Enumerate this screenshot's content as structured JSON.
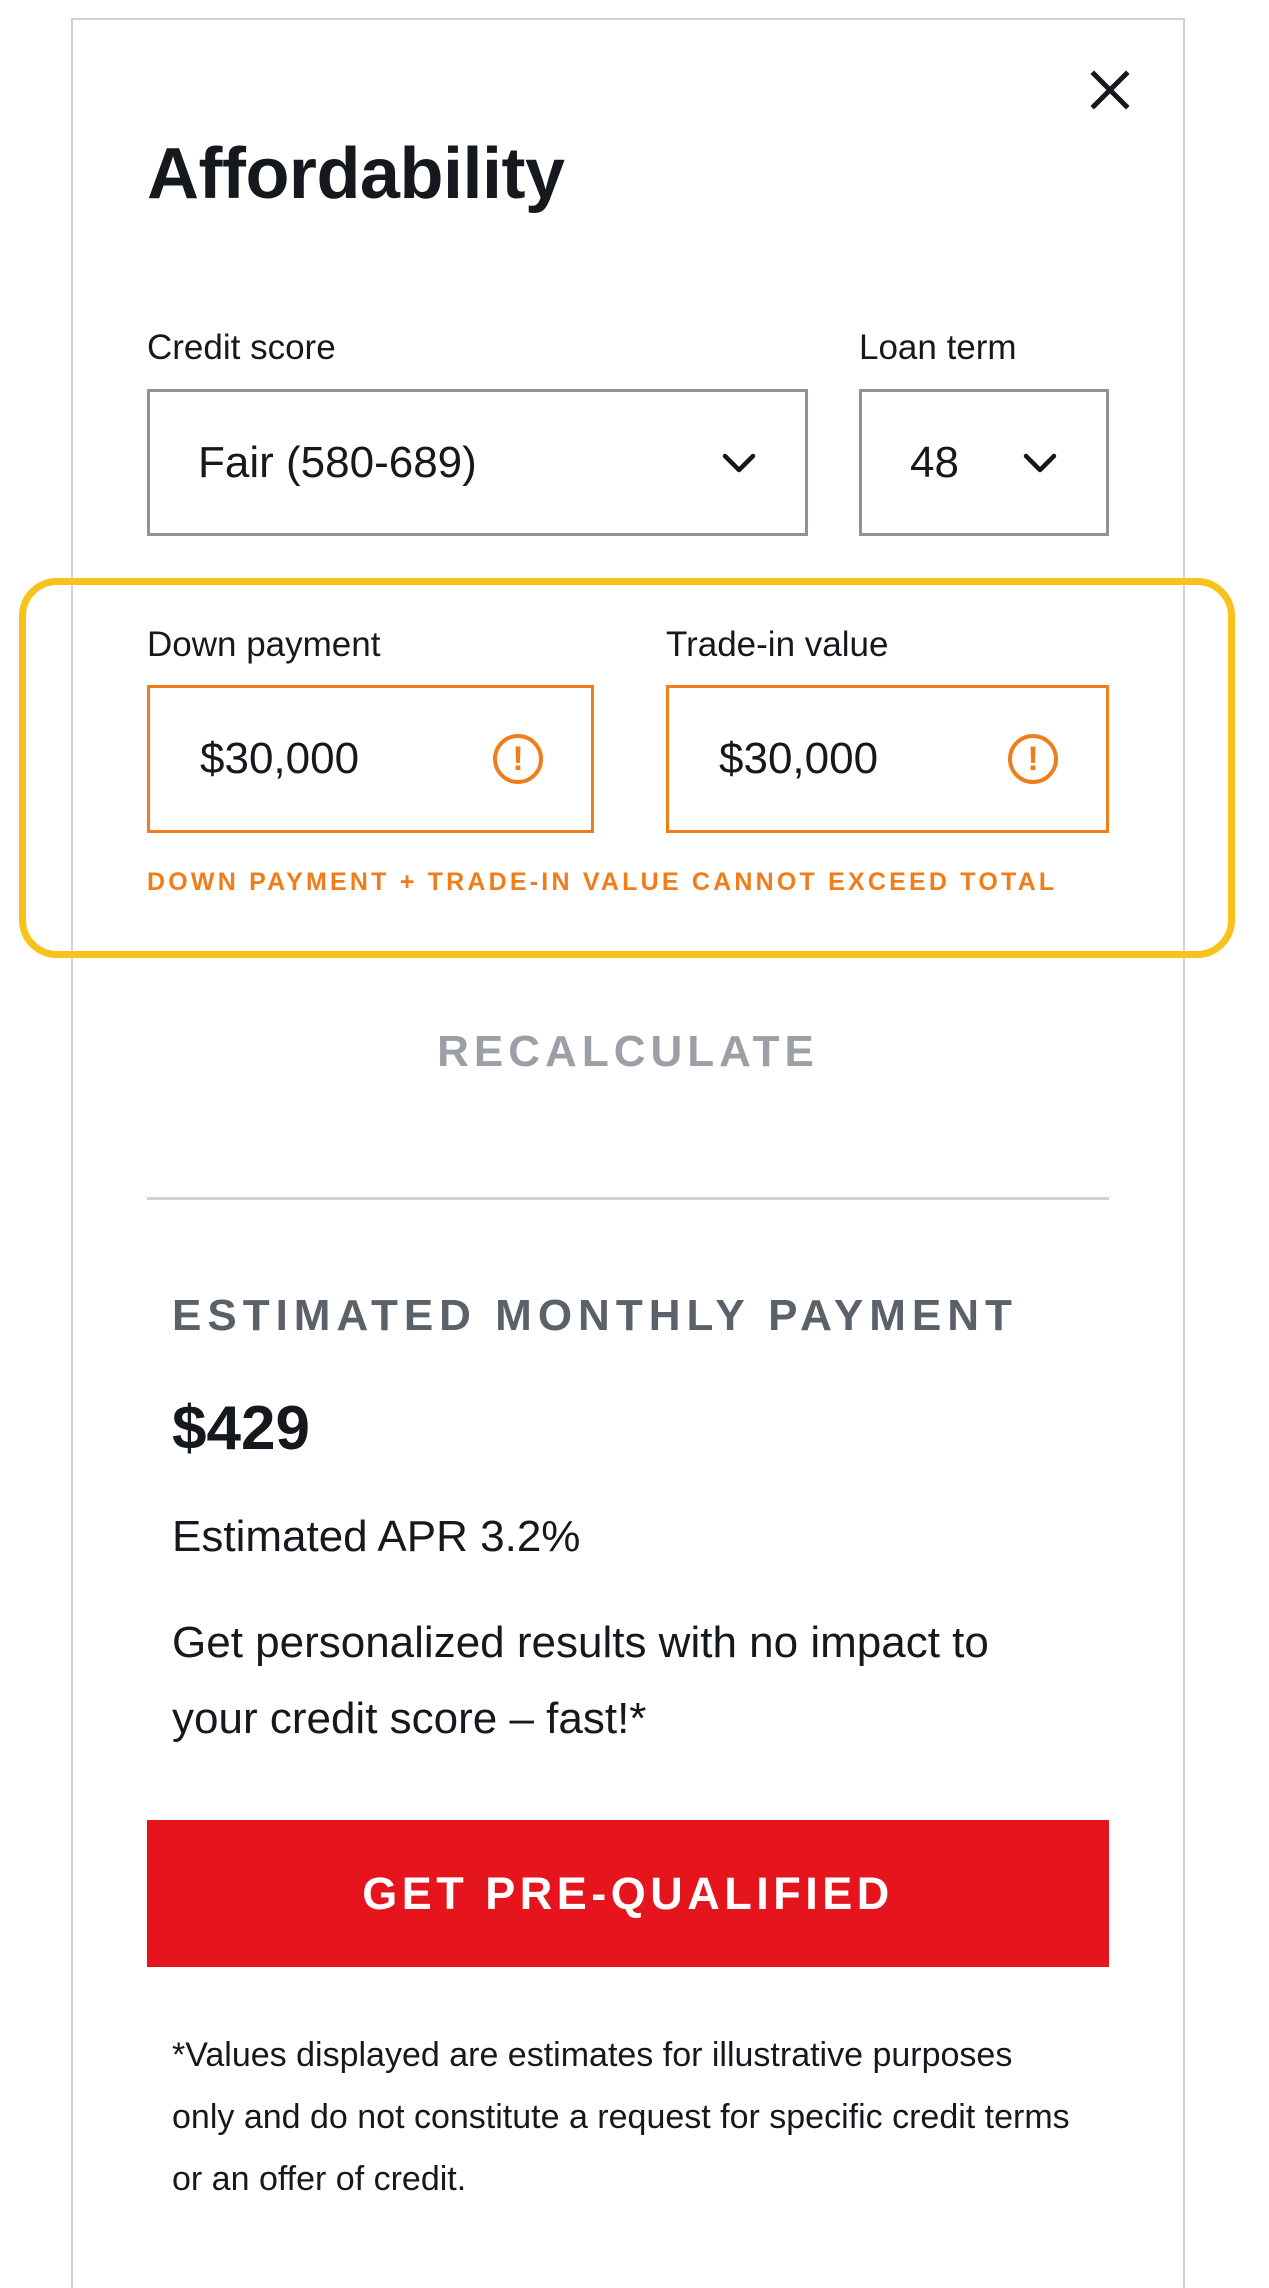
{
  "header": {
    "title": "Affordability",
    "close_icon": "close-icon"
  },
  "credit_score": {
    "label": "Credit score",
    "selected": "Fair (580-689)"
  },
  "loan_term": {
    "label": "Loan term",
    "selected": "48"
  },
  "down_payment": {
    "label": "Down payment",
    "value": "$30,000",
    "icon": "warning-icon"
  },
  "trade_in": {
    "label": "Trade-in value",
    "value": "$30,000",
    "icon": "warning-icon"
  },
  "error_message": "DOWN PAYMENT + TRADE-IN VALUE CANNOT EXCEED TOTAL",
  "recalculate_label": "RECALCULATE",
  "estimate": {
    "heading": "ESTIMATED MONTHLY PAYMENT",
    "amount": "$429",
    "apr": "Estimated APR 3.2%",
    "promo": "Get personalized results with no impact to your credit score – fast!*"
  },
  "cta_label": "GET PRE-QUALIFIED",
  "disclaimer": "*Values displayed are estimates for illustrative purposes only and do not constitute a request for specific credit terms or an offer of credit.",
  "colors": {
    "error_orange": "#f07d1a",
    "cta_red": "#e5141d",
    "highlight_yellow": "#f7c31a",
    "muted_gray": "#9b9fa6"
  }
}
